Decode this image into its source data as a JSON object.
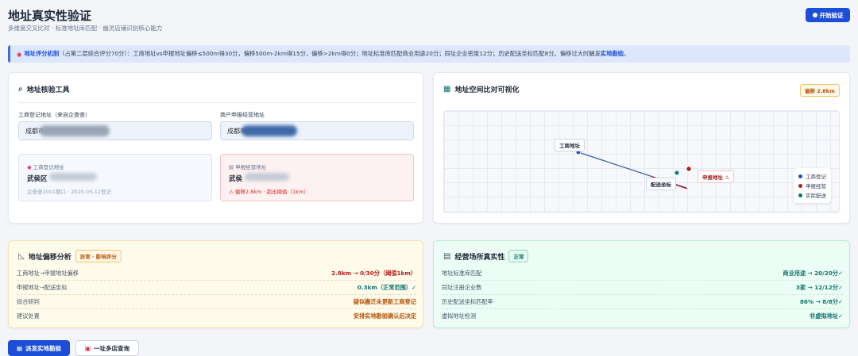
{
  "header": {
    "title": "地址真实性验证",
    "subtitle": "多维度交叉比对 · 标准地址库匹配 · 幽灵店铺识别核心能力",
    "start_button": "开始验证"
  },
  "banner": {
    "lead": "地址评分机制",
    "text": "（占第二层综合评分70分）：工商地址vs申报地址偏移≤500m得30分，偏移500m-2km得15分，偏移>2km得0分；地址标准库匹配商业用途20分；同址企业密度12分；历史配送坐标匹配8分。偏移过大时触发",
    "link": "实地勘验",
    "tail": "。"
  },
  "tool": {
    "title": "地址核验工具",
    "reg_label": "工商登记地址（来自企查查）",
    "reg_value": "成都市",
    "decl_label": "商户申报经营地址",
    "decl_value": "成都市",
    "reg_card": {
      "title": "工商登记地址",
      "value": "武侯区",
      "meta": "企查查2001期口 · 2020-05-12登记"
    },
    "decl_card": {
      "title": "申报经营地址",
      "value": "武侯",
      "meta": "偏移2.8km · 超出阈值（1km）"
    }
  },
  "map": {
    "title": "地址空间比对可视化",
    "badge": "偏移 2.8km",
    "labels": {
      "reg": "工商地址",
      "decl": "申报地址",
      "delivery": "配送坐标"
    },
    "legend": [
      {
        "label": "工商登记",
        "color": "#1d4ed8"
      },
      {
        "label": "申报经营",
        "color": "#b91c1c"
      },
      {
        "label": "实际配送",
        "color": "#0f766e"
      }
    ]
  },
  "offset": {
    "title": "地址偏移分析",
    "tag": "异常 · 影响评分",
    "rows": [
      {
        "k": "工商地址→申报地址偏移",
        "v": "2.8km → 0/30分（阈值1km）"
      },
      {
        "k": "申报地址→配送坐标",
        "v": "0.3km（正常范围）✓"
      },
      {
        "k": "综合研判",
        "v": "疑似搬迁未更新工商登记"
      },
      {
        "k": "建议处置",
        "v": "安排实地勘验确认后决定"
      }
    ]
  },
  "site": {
    "title": "经营场所真实性",
    "tag": "正常",
    "rows": [
      {
        "k": "地址标准库匹配",
        "v": "商业用途 → 20/20分✓"
      },
      {
        "k": "同址注册企业数",
        "v": "3家 → 12/12分✓"
      },
      {
        "k": "历史配送坐标匹配率",
        "v": "86% → 8/8分✓"
      },
      {
        "k": "虚拟地址检测",
        "v": "非虚拟地址✓"
      }
    ]
  },
  "actions": {
    "dispatch": "派发实地勘验",
    "multi": "一址多店查询"
  }
}
